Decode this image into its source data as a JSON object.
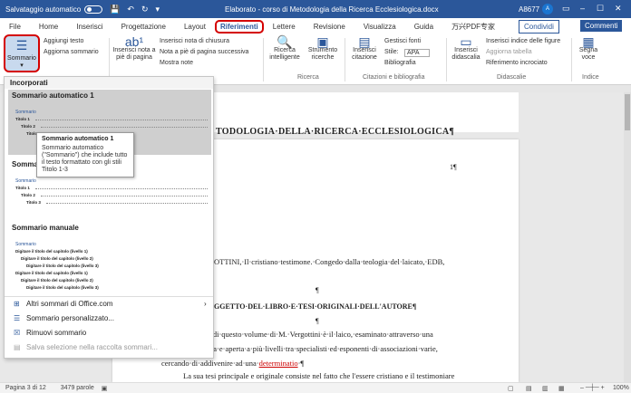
{
  "titlebar": {
    "autosave_label": "Salvataggio automatico",
    "autosave_state": "off",
    "title": "Elaborato - corso di Metodologia della Ricerca Ecclesiologica.docx",
    "user": "A8677",
    "avatar_initial": "A"
  },
  "tabs": [
    "File",
    "Home",
    "Inserisci",
    "Progettazione",
    "Layout",
    "Riferimenti",
    "Lettere",
    "Revisione",
    "Visualizza",
    "Guida",
    "万兴PDF专家"
  ],
  "active_tab": "Riferimenti",
  "share_label": "Condividi",
  "comments_label": "Commenti",
  "ribbon": {
    "sommario": "Sommario",
    "aggiungi_testo": "Aggiungi testo",
    "aggiorna_sommario": "Aggiorna sommario",
    "inserisci_nota": "Inserisci nota a piè di pagina",
    "inserisci_nota_chiusura": "Inserisci nota di chiusura",
    "nota_successiva": "Nota a piè di pagina successiva",
    "mostra_note": "Mostra note",
    "ricerca_intelligente": "Ricerca intelligente",
    "strumento_ricerche": "Strumento ricerche",
    "group_ricerca": "Ricerca",
    "inserisci_citazione": "Inserisci citazione",
    "gestisci_fonti": "Gestisci fonti",
    "stile_label": "Stile:",
    "stile_value": "APA",
    "bibliografia": "Bibliografia",
    "group_citazioni": "Citazioni e bibliografia",
    "inserisci_didascalia": "Inserisci didascalia",
    "inserisci_indice_figure": "Inserisci indice delle figure",
    "aggiorna_tabella": "Aggiorna tabella",
    "riferimento_incrociato": "Riferimento incrociato",
    "group_didascalie": "Didascalie",
    "segna_voce": "Segna voce",
    "group_indice": "Indice"
  },
  "dropdown": {
    "header": "Incorporati",
    "item1_title": "Sommario automatico 1",
    "item1_preview_heading": "Sommario",
    "item1_lines": [
      "Titolo 1",
      "Titolo 2",
      "Titolo 3"
    ],
    "item2_title": "Sommario automatico 2",
    "item2_preview_heading": "Sommario",
    "item2_lines": [
      "Titolo 1",
      "Titolo 2",
      "Titolo 3"
    ],
    "item3_title": "Sommario manuale",
    "item3_preview_heading": "Sommario",
    "item3_lines": [
      "Digitare il titolo del capitolo (livello 1)",
      "Digitare il titolo del capitolo (livello 2)",
      "Digitare il titolo del capitolo (livello 3)",
      "Digitare il titolo del capitolo (livello 1)",
      "Digitare il titolo del capitolo (livello 2)",
      "Digitare il titolo del capitolo (livello 3)"
    ],
    "menu_altri": "Altri sommari di Office.com",
    "menu_personalizzato": "Sommario personalizzato...",
    "menu_rimuovi": "Rimuovi sommario",
    "menu_salva": "Salva selezione nella raccolta sommari..."
  },
  "tooltip": {
    "title": "Sommario automatico 1",
    "desc": "Sommario automatico (\"Sommario\") che include tutto il testo formattato con gli stili Titolo 1-3"
  },
  "document": {
    "page_number": "1¶",
    "heading": "TODOLOGIA·DELLA·RICERCA·ECCLESIOLOGICA¶",
    "ref_line": "OTTINI,·Il·cristiano·testimone.·Congedo·dalla·teologia·del·laicato,·EDB,",
    "pilcrow": "¶",
    "section_heading": "GGETTO·DEL·LIBRO·E·TESI·ORIGINALI·DELL'AUTORE¶",
    "para1": "·di·questo·volume·di·M.·Vergottini·è·il·laico,·esaminato·attraverso·una",
    "para2": "sa·e·aperta·a·più·livelli·tra·specialisti·ed·esponenti·di·associazioni·varie,",
    "para3_a": "cercando·di·addivenire·ad·una·",
    "para3_link": "determinatio",
    "para3_b": "·¶",
    "para4": "La sua tesi principale e originale consiste nel fatto che l'essere cristiano e il testimoniare"
  },
  "statusbar": {
    "page": "Pagina 3 di 12",
    "words": "3479 parole",
    "zoom": "100%"
  }
}
